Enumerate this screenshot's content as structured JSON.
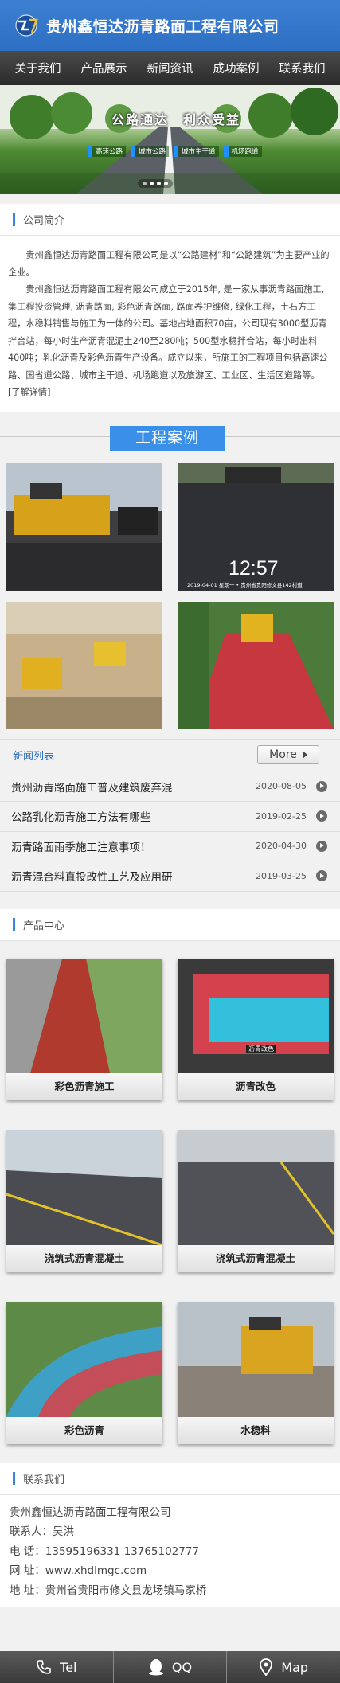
{
  "header": {
    "title": "贵州鑫恒达沥青路面工程有限公司"
  },
  "nav": {
    "items": [
      "关于我们",
      "产品展示",
      "新闻资讯",
      "成功案例",
      "联系我们"
    ]
  },
  "banner": {
    "slogan": "公路通达　利众受益",
    "chips": [
      "高速公路",
      "城市公路",
      "城市主干道",
      "机场跑道"
    ],
    "slide_count": 4,
    "active_slide": 1
  },
  "about": {
    "heading": "公司简介",
    "para1": "贵州鑫恒达沥青路面工程有限公司是以“公路建材”和“公路建筑”为主要产业的企业。",
    "para2": "贵州鑫恒达沥青路面工程有限公司成立于2015年, 是一家从事沥青路面施工,集工程投资管理, 沥青路面, 彩色沥青路面, 路面养护维修, 绿化工程，土石方工程，水稳料销售与施工为一体的公司。基地占地面积70亩，公司现有3000型沥青拌合站，每小时生产沥青混泥土240至280吨；500型水稳拌合站，每小时出料400吨；乳化沥青及彩色沥青生产设备。成立以来，所施工的工程项目包括高速公路、国省道公路、城市主干道、机场跑道以及旅游区、工业区、生活区道路等。[了解详情]"
  },
  "cases": {
    "title": "工程案例",
    "video_time": "12:57",
    "video_stamp": "2019-04-01 星期一 • 贵州省贵阳修文县142村道"
  },
  "news": {
    "heading": "新闻列表",
    "more_label": "More",
    "items": [
      {
        "title": "贵州沥青路面施工普及建筑废弃混",
        "date": "2020-08-05"
      },
      {
        "title": "公路乳化沥青施工方法有哪些",
        "date": "2019-02-25"
      },
      {
        "title": "沥青路面雨季施工注意事项！",
        "date": "2020-04-30"
      },
      {
        "title": "沥青混合料直投改性工艺及应用研",
        "date": "2019-03-25"
      }
    ]
  },
  "products": {
    "heading": "产品中心",
    "items": [
      {
        "caption": "彩色沥青施工",
        "overlay": ""
      },
      {
        "caption": "沥青改色",
        "overlay": "沥青改色"
      },
      {
        "caption": "浇筑式沥青混凝土",
        "overlay": ""
      },
      {
        "caption": "浇筑式沥青混凝土",
        "overlay": ""
      },
      {
        "caption": "彩色沥青",
        "overlay": ""
      },
      {
        "caption": "水稳料",
        "overlay": ""
      }
    ]
  },
  "contact": {
    "heading": "联系我们",
    "company": "贵州鑫恒达沥青路面工程有限公司",
    "person": "联系人：吴洪",
    "phone": "电  话：13595196331   13765102777",
    "website": "网  址：www.xhdlmgc.com",
    "address": "地  址：贵州省贵阳市修文县龙场镇马家桥"
  },
  "footer": {
    "tel": "Tel",
    "qq": "QQ",
    "map": "Map"
  },
  "colors": {
    "brand_blue": "#2d6fc4",
    "accent_blue": "#3a8fe8",
    "nav_dark": "#2b2b2b"
  }
}
